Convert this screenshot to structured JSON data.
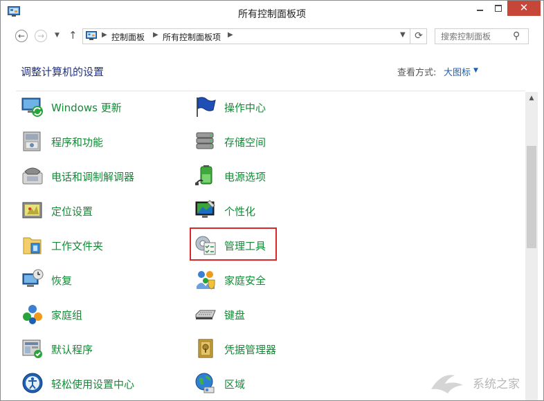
{
  "window": {
    "title": "所有控制面板项",
    "close_glyph": "✕"
  },
  "nav": {
    "back_glyph": "←",
    "forward_glyph": "→",
    "recent_glyph": "▼",
    "up_glyph": "↑",
    "address": {
      "sep_glyph": "▶",
      "crumbs": [
        "控制面板",
        "所有控制面板项"
      ],
      "dropdown_glyph": "▼",
      "refresh_glyph": "⟳"
    },
    "search": {
      "placeholder": "搜索控制面板",
      "icon_glyph": "⚲"
    }
  },
  "content": {
    "title": "调整计算机的设置",
    "view_by_label": "查看方式:",
    "view_by_value": "大图标",
    "view_by_caret": "▼"
  },
  "items": {
    "left": [
      {
        "label": "Windows 更新",
        "icon": "windows-update-icon"
      },
      {
        "label": "程序和功能",
        "icon": "programs-features-icon"
      },
      {
        "label": "电话和调制解调器",
        "icon": "phone-modem-icon"
      },
      {
        "label": "定位设置",
        "icon": "location-settings-icon"
      },
      {
        "label": "工作文件夹",
        "icon": "work-folders-icon"
      },
      {
        "label": "恢复",
        "icon": "recovery-icon"
      },
      {
        "label": "家庭组",
        "icon": "homegroup-icon"
      },
      {
        "label": "默认程序",
        "icon": "default-programs-icon"
      },
      {
        "label": "轻松使用设置中心",
        "icon": "ease-of-access-icon"
      }
    ],
    "right": [
      {
        "label": "操作中心",
        "icon": "action-center-icon"
      },
      {
        "label": "存储空间",
        "icon": "storage-spaces-icon"
      },
      {
        "label": "电源选项",
        "icon": "power-options-icon"
      },
      {
        "label": "个性化",
        "icon": "personalization-icon"
      },
      {
        "label": "管理工具",
        "icon": "administrative-tools-icon"
      },
      {
        "label": "家庭安全",
        "icon": "family-safety-icon"
      },
      {
        "label": "键盘",
        "icon": "keyboard-icon"
      },
      {
        "label": "凭据管理器",
        "icon": "credential-manager-icon"
      },
      {
        "label": "区域",
        "icon": "region-icon"
      }
    ]
  },
  "scrollbar": {
    "up_glyph": "▲"
  },
  "watermark": {
    "text": "系统之家"
  },
  "colors": {
    "link_green": "#138a36",
    "title_blue": "#1e3287",
    "accent_blue": "#1e5fb4",
    "highlight_red": "#d9262b",
    "close_red": "#c7463a"
  }
}
